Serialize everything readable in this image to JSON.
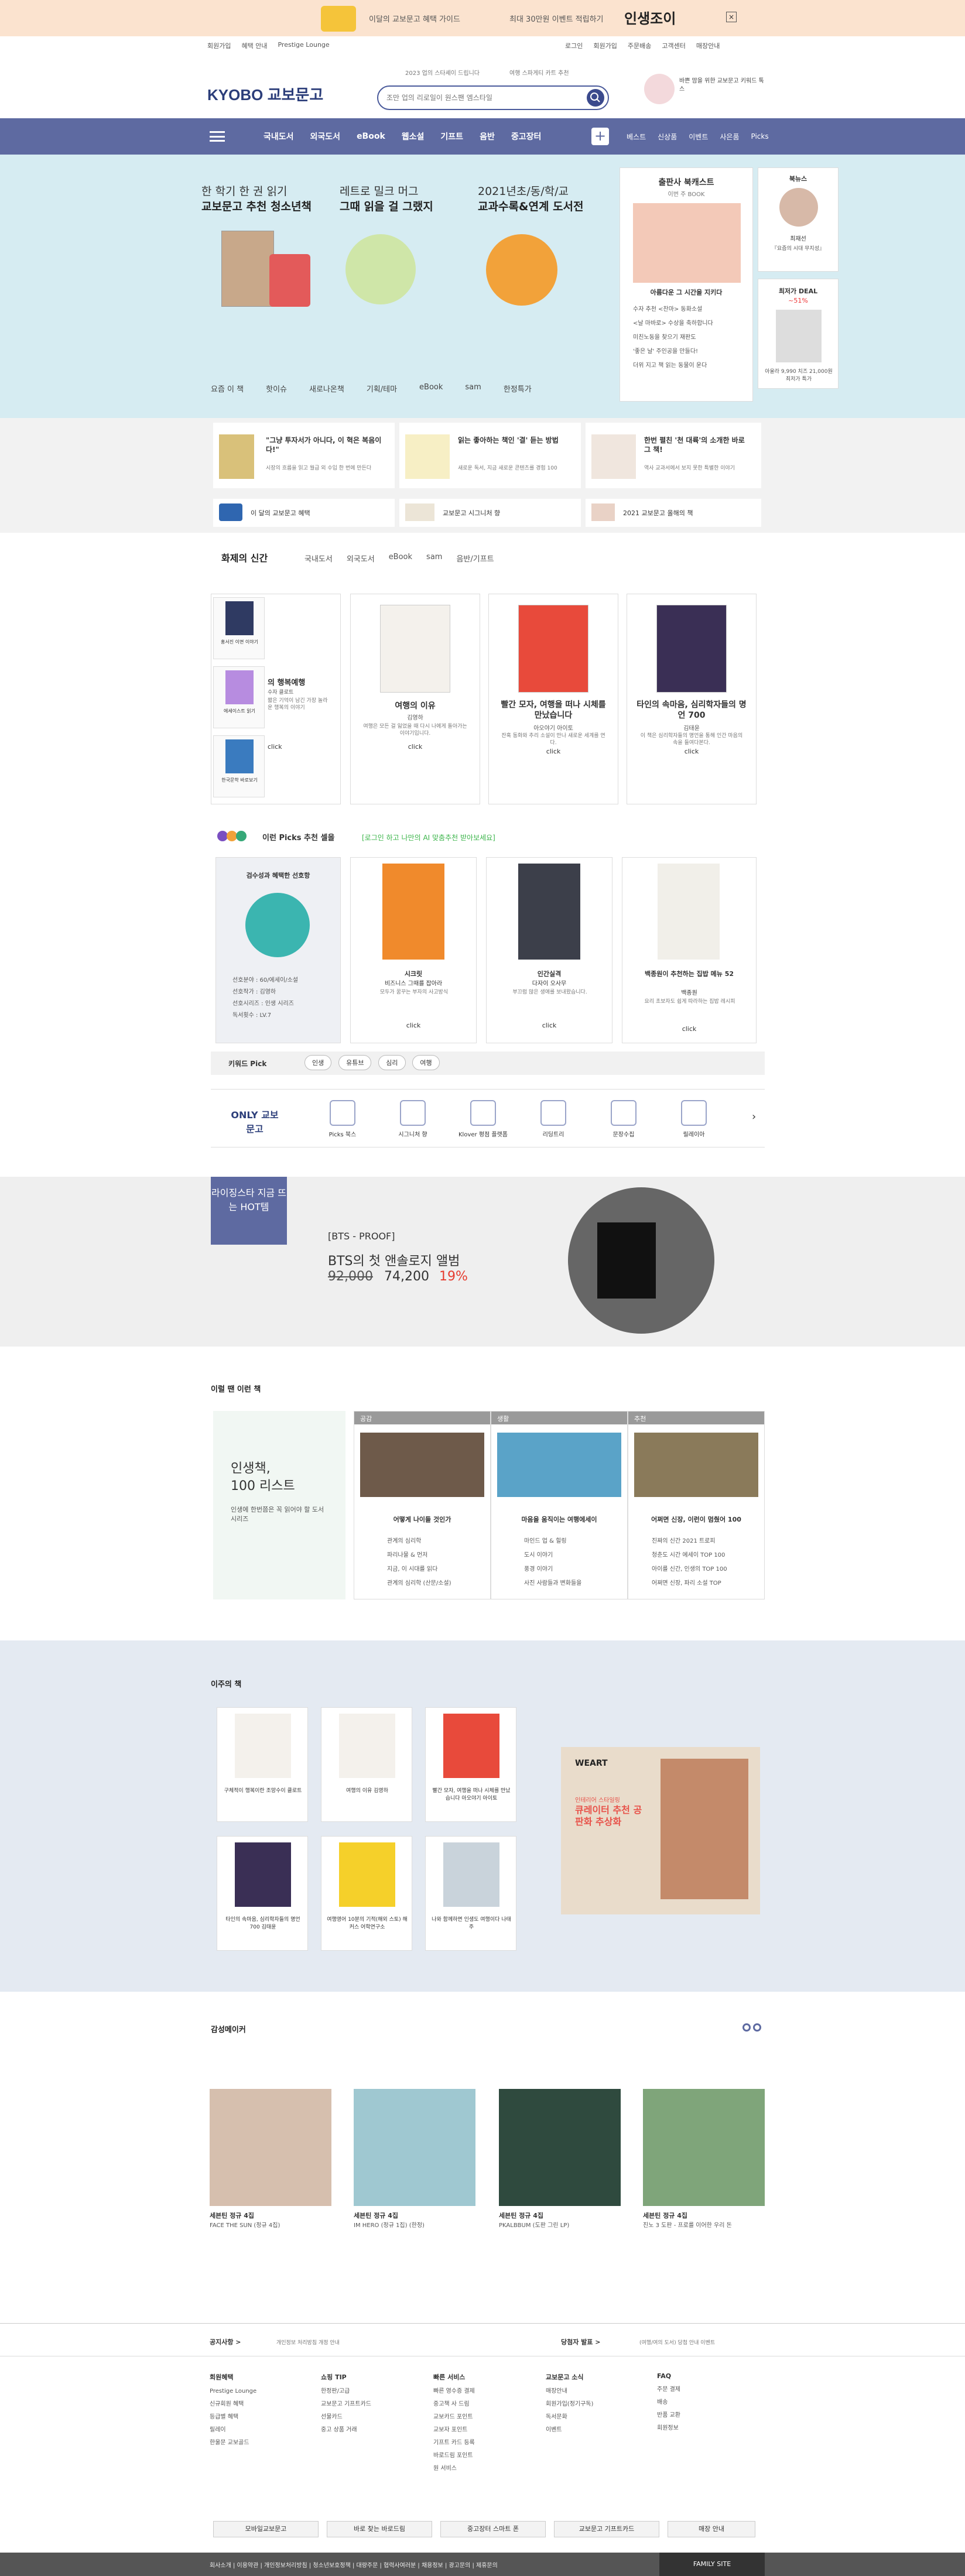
{
  "top_banner": {
    "text_left": "이달의 교보문고 혜택 가이드",
    "text_mid": "최대 30만원 이벤트 적립하기",
    "text_logo": "인생조이"
  },
  "util_left": [
    "회원가입",
    "혜택 안내",
    "Prestige Lounge"
  ],
  "util_right": [
    "로그인",
    "회원가입",
    "주문배송",
    "고객센터",
    "매장안내"
  ],
  "logo": "KYOBO 교보문고",
  "search": {
    "placeholder": "조만 업의 리로일이 원스팬 엠스타일"
  },
  "search_hint1": "2023 업의 스타셰이 드립니다",
  "search_hint2": "여행 스파게티 카트 추천",
  "header_ad": "바쁜 맘을 위한 교보문고 키워드 톡스",
  "gnb_menu": [
    "국내도서",
    "외국도서",
    "eBook",
    "웹소설",
    "기프트",
    "음반",
    "중고장터"
  ],
  "gnb_right": [
    "베스트",
    "신상품",
    "이벤트",
    "사은품",
    "Picks"
  ],
  "hero": {
    "slides": [
      {
        "title1": "한 학기 한 권 읽기",
        "title2": "교보문고 추천 청소년책"
      },
      {
        "title1": "레트로 밀크 머그",
        "title2": "그때 읽을 걸 그랬지"
      },
      {
        "title1": "2021년초/동/학/교",
        "title2": "교과수록&연계 도서전"
      }
    ],
    "tabs": [
      "요즘 이 책",
      "핫이슈",
      "새로나온책",
      "기획/테마",
      "eBook",
      "sam",
      "한정특가"
    ],
    "right_title": "출판사 북캐스트",
    "right_sub": "이번 주 BOOK",
    "right_book": "아름다운 그 시간을 지키다",
    "right_items": [
      "수자 추천 <찬마> 동화소설",
      "<날 마바로> 수상을 축하합니다",
      "미친노동을 찾으기 재판도",
      "'좋은 날' 주인공을 만들다!",
      "더위 지고 책 읽는 동물이 운다"
    ],
    "side_title": "북뉴스",
    "side_name": "최재선",
    "side_caption": "『요즘의 시대 무지성』",
    "side_deal_title": "최저가 DEAL",
    "side_deal_pct": "~51%",
    "side_deal_price": "아울라 9,990 치즈 21,000원 최저가 특가"
  },
  "ad_cards": [
    {
      "quote": "\"그냥 투자서가 아니다, 이 혁은 복음이다!\"",
      "desc": "시장의 흐름을 읽고 월급 외 수입 한 번에 만든다"
    },
    {
      "quote": "읽는 좋아하는 책인 '결' 듣는 방법",
      "desc": "새로운 독서, 지금 새로운 콘텐츠를 경험 100"
    },
    {
      "quote": "한번 펼친 '천 대륙'의 소개한 바로 그 책!",
      "desc": "역사 교과서에서 보지 못한 특별한 이야기"
    }
  ],
  "ad_row2": [
    "이 달의 교보문고 혜택",
    "교보문고 시그니처 향",
    "2021 교보문고 올해의 책"
  ],
  "new_books": {
    "title": "화제의 신간",
    "tabs": [
      "국내도서",
      "외국도서",
      "eBook",
      "sam",
      "음반/기프트"
    ],
    "thumbs": [
      "홍서진 이면 이야기",
      "에세이스트 읽기",
      "한국문학 바로보기"
    ],
    "cards": [
      {
        "title": "의 행복예행",
        "author": "수자 클로트",
        "desc": "짧은 기억이 남긴 가장 놀라운 행복의 이야기",
        "cta": "click"
      },
      {
        "title": "여행의 이유",
        "author": "김영하",
        "desc": "여행은 모든 걸 잃었을 때 다시 나에게 돌아가는 이야기입니다.",
        "cta": "click"
      },
      {
        "title": "빨간 모자, 여행을 떠나 시체를 만났습니다",
        "author": "아오야기 아이토",
        "desc": "잔혹 동화와 추리 소설이 만나 새로운 세계를 연다.",
        "cta": "click"
      },
      {
        "title": "타인의 속마음, 심리학자들의 명언 700",
        "author": "김태윤",
        "desc": "이 책은 심리학자들의 명언을 통해 인간 마음의 속을 들여다본다.",
        "cta": "click"
      }
    ]
  },
  "picks": {
    "title": "이런 Picks 추천 셀을",
    "subtitle": "[로그인 하고 나만의 AI 맞춤추천 받아보세요]",
    "left_card_title": "검수성과 혜택한 선호항",
    "left_list": [
      "선호분야 : 60/에세이/소설",
      "선호작가 : 김영하",
      "선호시리즈 : 인생 시리즈",
      "독서횟수 : LV.7"
    ],
    "cards": [
      {
        "title": "시크릿",
        "subtitle": "비즈니스 그때를 잡아라",
        "desc": "모두가 꿈꾸는 부자의 사고방식",
        "cta": "click"
      },
      {
        "title": "인간실격",
        "subtitle": "다자이 오사무",
        "desc": "부끄럼 많은 생애를 보내왔습니다.",
        "cta": "click"
      },
      {
        "title": "백종원이 추천하는 집밥 메뉴 52",
        "subtitle": "백종원",
        "desc": "요리 초보자도 쉽게 따라하는 집밥 레시피",
        "cta": "click"
      }
    ],
    "keyword_label": "키워드 Pick",
    "keywords": [
      "인생",
      "유튜브",
      "심리",
      "여행"
    ]
  },
  "only": {
    "label": "ONLY 교보문고",
    "items": [
      "Picks 북스",
      "시그니처 향",
      "Klover 평점 플랫폼",
      "리딩트리",
      "문장수집",
      "릴레이아"
    ]
  },
  "bts": {
    "badge": "라이징스타 지금 뜨는 HOT템",
    "title": "[BTS - PROOF]",
    "subtitle": "BTS의 첫 앤솔로지 앨범",
    "price_orig": "92,000",
    "price_now": "74,200",
    "discount": "19%"
  },
  "life": {
    "title": "이럴 땐 이런 책",
    "left_title1": "인생책,",
    "left_title2": "100 리스트",
    "left_desc": "인생에 한번쯤은 꼭 읽어야 할 도서 시리즈",
    "cols": [
      {
        "head": "공감",
        "title": "어떻게 나이들 것인가",
        "items": [
          "관계의 심리학",
          "파리나물 & 먼저",
          "지금, 이 시대를 읽다",
          "관계의 심리학 (산문/소설)"
        ]
      },
      {
        "head": "생활",
        "title": "마음을 움직이는 여행에세이",
        "items": [
          "마인드 업 & 힐링",
          "도시 이야기",
          "풍경 이야기",
          "사진 사람들과 변화들을"
        ]
      },
      {
        "head": "추천",
        "title": "어쩌면 신장, 이런이 멈췄어 100",
        "items": [
          "진짜의 신간 2021 트로피",
          "청춘도 시간 에세이 TOP 100",
          "아이를 신간, 인생의 TOP 100",
          "어쩌면 신장, 파리 소설 TOP"
        ]
      }
    ]
  },
  "weekly": {
    "title": "이주의 책",
    "books": [
      {
        "title": "구체적이 행복이란 조망수이 클로트"
      },
      {
        "title": "여행의 이유 김영하"
      },
      {
        "title": "빨간 모자, 여행을 떠나 시체를 만났습니다 아오야기 아이토"
      },
      {
        "title": "타인의 속마음, 심리학자들의 명언 700 김태윤"
      },
      {
        "title": "여행영어 10분의 기적(해외 스토) 해커스 어학연구소"
      },
      {
        "title": "나와 함께하면 인생도 여행이다 나태주"
      }
    ],
    "ad_label": "WEART",
    "ad_title": "큐레이터 추천 공판화 추상화",
    "ad_sub": "인테리어 스타일링"
  },
  "music": {
    "title": "감성메이커",
    "items": [
      {
        "title": "세븐틴 정규 4집",
        "desc": "FACE THE SUN (정규 4집)"
      },
      {
        "title": "세븐틴 정규 4집",
        "desc": "IM HERO (정규 1집) (한정)"
      },
      {
        "title": "세븐틴 정규 4집",
        "desc": "PKALBBUM (도판 그린 LP)"
      },
      {
        "title": "세븐틴 정규 4집",
        "desc": "진노 3 도판 - 프로를 이어한 우리 돈"
      }
    ]
  },
  "footer": {
    "notice_label": "공지사항 >",
    "notice_text": "개인정보 처리방침 개정 안내",
    "event_label": "당첨자 발표 >",
    "event_text": "(여행/여의 도서) 당첨 안내 이벤트",
    "cols": [
      {
        "head": "회원혜택",
        "items": [
          "Prestige Lounge",
          "신규회원 혜택",
          "등급별 혜택",
          "릴레이",
          "한울문 교보골드"
        ]
      },
      {
        "head": "쇼핑 TIP",
        "items": [
          "한정판/고급",
          "교보문고 기프트카드",
          "선물카드",
          "중고 상품 거래"
        ]
      },
      {
        "head": "빠른 서비스",
        "items": [
          "빠른 영수증 결제",
          "중고책 사 드림",
          "교보카드 포인트",
          "교보자 포인트",
          "기프트 카드 등록",
          "바로드림 포인트",
          "원 서비스"
        ]
      },
      {
        "head": "교보문고 소식",
        "items": [
          "매장안내",
          "회원가입(정기구독)",
          "독서문화",
          "이벤트"
        ]
      },
      {
        "head": "FAQ",
        "items": [
          "주문 결제",
          "배송",
          "반품 교환",
          "회원정보"
        ]
      }
    ],
    "buttons": [
      "모바일교보문고",
      "바로 찾는 바로드림",
      "중고장터 스마트 폰",
      "교보문고 기프트카드",
      "매장 안내"
    ],
    "bottom_links": "회사소개 | 이용약관 | 개인정보처리방침 | 청소년보호정책 | 대량주문 | 협력사여러분 | 채용정보 | 광고문의 | 제휴문의",
    "family": "FAMILY SITE"
  }
}
